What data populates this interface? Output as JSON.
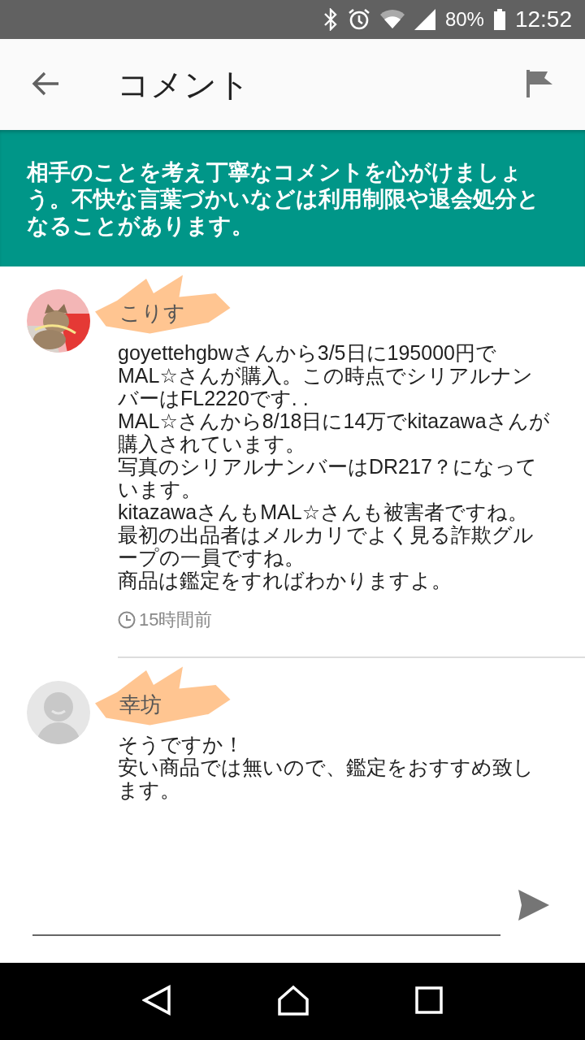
{
  "status_bar": {
    "battery": "80%",
    "time": "12:52"
  },
  "app_bar": {
    "title": "コメント"
  },
  "notice": "相手のことを考え丁寧なコメントを心がけましょう。不快な言葉づかいなどは利用制限や退会処分となることがあります。",
  "comments": [
    {
      "name": "こりす",
      "lines": [
        "goyettehgbwさんから3/5日に195000円でMAL☆さんが購入。この時点でシリアルナンバーはFL2220です. .",
        "MAL☆さんから8/18日に14万でkitazawaさんが購入されています。",
        "写真のシリアルナンバーはDR217？になっています。",
        "kitazawaさんもMAL☆さんも被害者ですね。",
        "最初の出品者はメルカリでよく見る詐欺グループの一員ですね。",
        "商品は鑑定をすればわかりますよ。"
      ],
      "time": "15時間前"
    },
    {
      "name": "幸坊",
      "avatar": {
        "kind": "default"
      },
      "lines": [
        "そうですか！",
        "安い商品では無いので、鑑定をおすすめ致します。"
      ]
    }
  ]
}
